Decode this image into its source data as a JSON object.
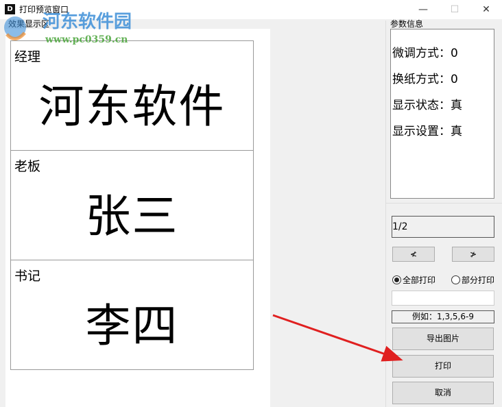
{
  "window": {
    "title": "打印预览窗口",
    "icon": "app-icon",
    "minimize": "—",
    "maximize": "☐",
    "close": "✕"
  },
  "preview": {
    "group_label": "效果显示区",
    "cards": [
      {
        "role": "经理",
        "name": "河东软件"
      },
      {
        "role": "老板",
        "name": "张三"
      },
      {
        "role": "书记",
        "name": "李四"
      }
    ]
  },
  "params": {
    "group_label": "参数信息",
    "rows": [
      "微调方式：0",
      "换纸方式：0",
      "显示状态：真",
      "显示设置：真"
    ]
  },
  "controls": {
    "page": "1/2",
    "prev": "≮",
    "next": "≯",
    "radio_all": "全部打印",
    "radio_part": "部分打印",
    "selected": "all",
    "range_value": "",
    "example": "例如：1,3,5,6-9",
    "export": "导出图片",
    "print": "打印",
    "cancel": "取消"
  },
  "watermark": {
    "text": "河东软件园",
    "url": "www.pc0359.cn"
  },
  "colors": {
    "arrow": "#e02020"
  }
}
